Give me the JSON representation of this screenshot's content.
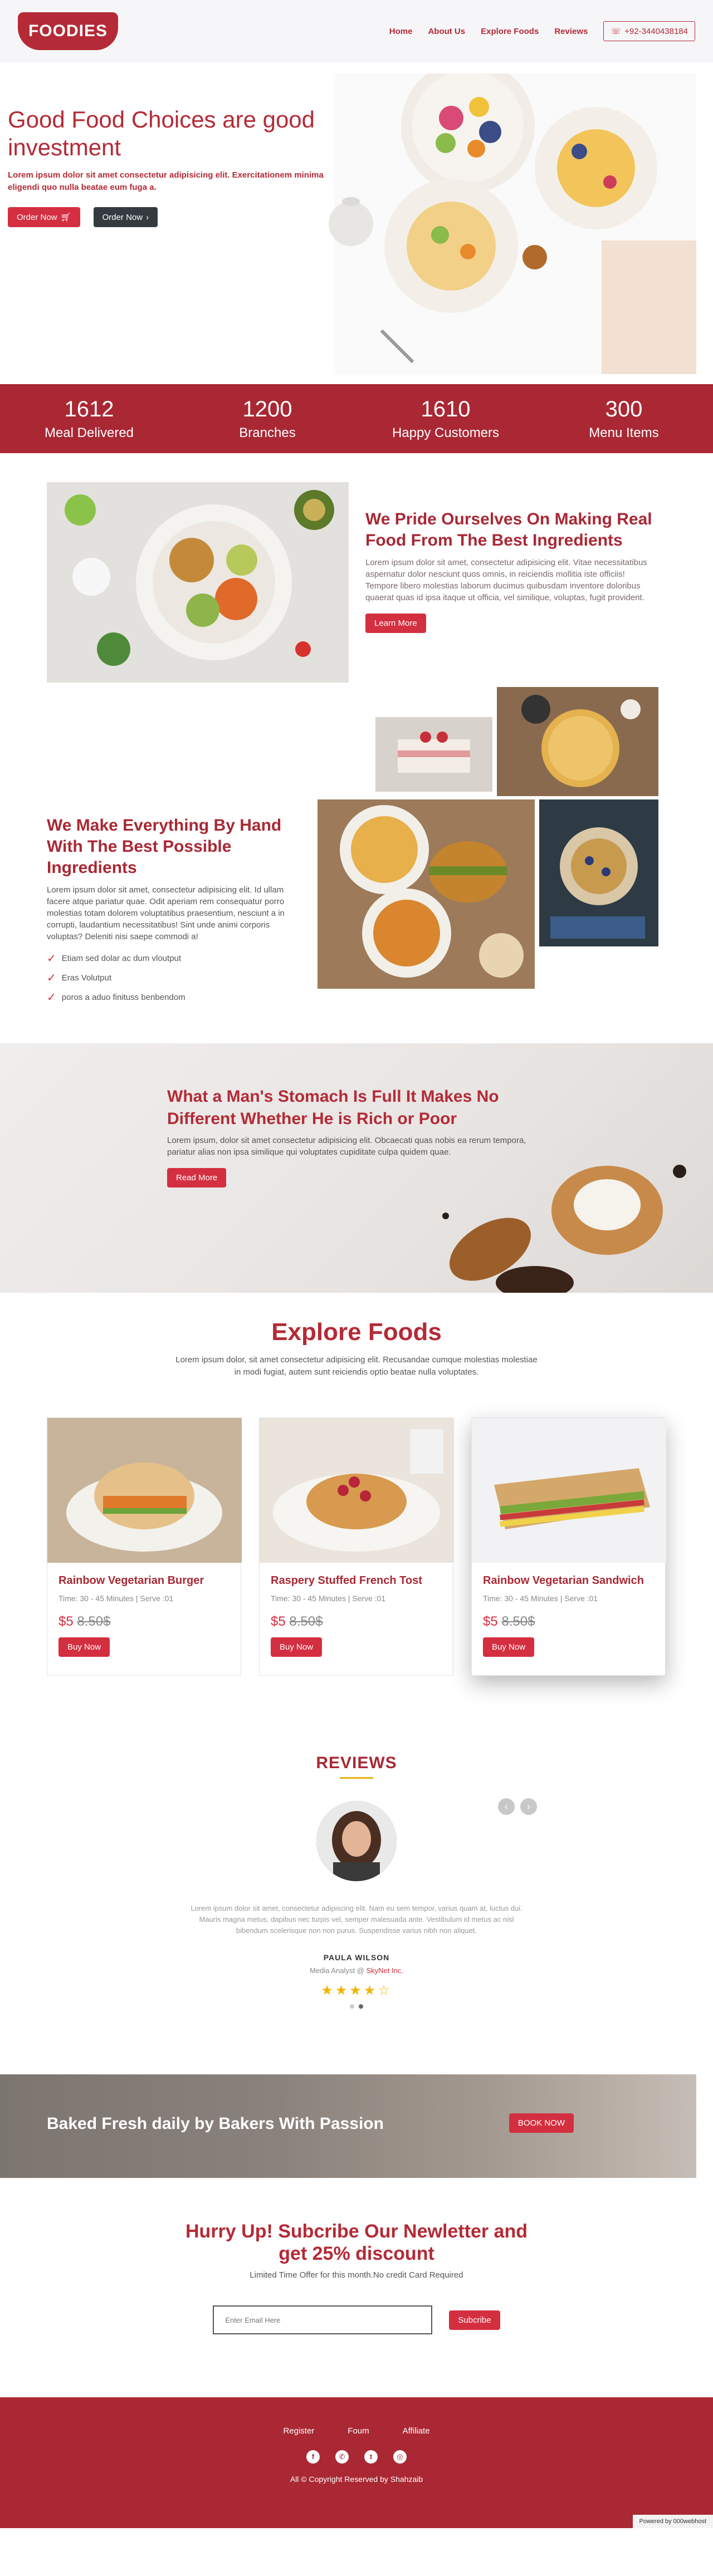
{
  "nav": {
    "logo": "FOODIES",
    "links": [
      "Home",
      "About Us",
      "Explore Foods",
      "Reviews"
    ],
    "phone": "+92-3440438184"
  },
  "hero": {
    "title": "Good Food Choices are good investment",
    "subtitle": "Lorem ipsum dolor sit amet consectetur adipisicing elit. Exercitationem minima eligendi quo nulla beatae eum fuga a.",
    "btn_order_1": "Order Now",
    "btn_order_2": "Order Now"
  },
  "stats": [
    {
      "num": "1612",
      "label": "Meal Delivered"
    },
    {
      "num": "1200",
      "label": "Branches"
    },
    {
      "num": "1610",
      "label": "Happy Customers"
    },
    {
      "num": "300",
      "label": "Menu Items"
    }
  ],
  "pride": {
    "title": "We Pride Ourselves On Making Real Food From The Best Ingredients",
    "body": "Lorem ipsum dolor sit amet, consectetur adipisicing elit. Vitae necessitatibus aspernatur dolor nesciunt quos omnis, in reiciendis mollitia iste officiis! Tempore libero molestias laborum ducimus quibusdam inventore doloribus quaerat quas id ipsa itaque ut officia, vel similique, voluptas, fugit provident.",
    "button": "Learn More"
  },
  "hand": {
    "title": "We Make Everything By Hand With The Best Possible Ingredients",
    "body": "Lorem ipsum dolor sit amet, consectetur adipisicing elit. Id ullam facere atque pariatur quae. Odit aperiam rem consequatur porro molestias totam dolorem voluptatibus praesentium, nesciunt a in corrupti, laudantium necessitatibus! Sint unde animi corporis voluptas? Deleniti nisi saepe commodi a!",
    "checks": [
      "Etiam sed dolar ac dum vloutput",
      "Eras Volutput",
      "poros a aduo finituss benbendom"
    ]
  },
  "quote": {
    "title": "What a Man's Stomach Is Full It Makes No Different Whether He is Rich or Poor",
    "body": "Lorem ipsum, dolor sit amet consectetur adipisicing elit. Obcaecati quas nobis ea rerum tempora, pariatur alias non ipsa similique qui voluptates cupiditate culpa quidem quae.",
    "button": "Read More"
  },
  "explore": {
    "title": "Explore Foods",
    "body": "Lorem ipsum dolor, sit amet consectetur adipisicing elit. Recusandae cumque molestias molestiae in modi fugiat, autem sunt reiciendis optio beatae nulla voluptates.",
    "cards": [
      {
        "title": "Rainbow Vegetarian Burger",
        "meta": "Time: 30 - 45 Minutes | Serve :01",
        "price": "$5",
        "old_price": "8.50$",
        "button": "Buy Now"
      },
      {
        "title": "Raspery Stuffed French Tost",
        "meta": "Time: 30 - 45 Minutes | Serve :01",
        "price": "$5",
        "old_price": "8.50$",
        "button": "Buy Now"
      },
      {
        "title": "Rainbow Vegetarian Sandwich",
        "meta": "Time: 30 - 45 Minutes | Serve :01",
        "price": "$5",
        "old_price": "8.50$",
        "button": "Buy Now"
      }
    ]
  },
  "reviews": {
    "title": "REVIEWS",
    "text": "Lorem ipsum dolor sit amet, consectetur adipiscing elit. Nam eu sem tempor, varius quam at, luctus dui. Mauris magna metus, dapibus nec turpis vel, semper malesuada ante. Vestibulum id metus ac nisl bibendum scelerisque non non purus. Suspendisse varius nibh non aliquet.",
    "name": "PAULA WILSON",
    "role_prefix": "Media Analyst @",
    "role_company": "SkyNet Inc.",
    "stars": "★★★★☆"
  },
  "baked": {
    "title": "Baked Fresh daily by Bakers With Passion",
    "button": "BOOK NOW"
  },
  "newsletter": {
    "title": "Hurry Up! Subcribe Our Newletter and get 25% discount",
    "sub": "Limited Time Offer for this month.No credit Card Required",
    "placeholder": "Enter Email Here",
    "button": "Subcribe"
  },
  "footer": {
    "links": [
      "Register",
      "Foum",
      "Affiliate"
    ],
    "copyright": "All © Copyright Reserved by Shahzaib",
    "powered": "Powered by 000webhost"
  },
  "colors": {
    "brand": "#a92834",
    "accent": "#d42f40"
  }
}
